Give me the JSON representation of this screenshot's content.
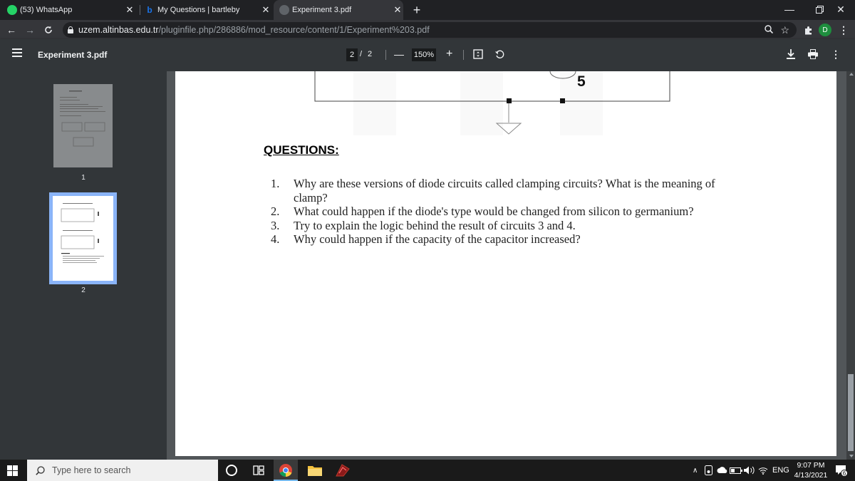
{
  "browser": {
    "tabs": [
      {
        "title": "(53) WhatsApp",
        "icon": "whatsapp-icon",
        "active": false
      },
      {
        "title": "My Questions | bartleby",
        "icon": "bartleby-icon",
        "active": false
      },
      {
        "title": "Experiment 3.pdf",
        "icon": "globe-icon",
        "active": true
      }
    ],
    "new_tab_label": "+",
    "url_host": "uzem.altinbas.edu.tr",
    "url_path": "/pluginfile.php/286886/mod_resource/content/1/Experiment%203.pdf",
    "profile_initial": "D"
  },
  "pdf_toolbar": {
    "title": "Experiment 3.pdf",
    "current_page": "2",
    "page_sep": "/",
    "total_pages": "2",
    "zoom": "150%",
    "zoom_out": "—",
    "zoom_in": "+"
  },
  "thumbnails": [
    {
      "page": "1",
      "selected": false
    },
    {
      "page": "2",
      "selected": true
    }
  ],
  "document": {
    "circuit_label": "5",
    "heading": "QUESTIONS:",
    "questions": [
      {
        "num": "1.",
        "text": "Why are these versions of diode circuits called clamping circuits? What is the meaning of clamp?"
      },
      {
        "num": "2.",
        "text": "What could happen if the diode's type would be changed from silicon to germanium?"
      },
      {
        "num": "3.",
        "text": "Try to explain the logic behind the result of circuits 3 and 4."
      },
      {
        "num": "4.",
        "text": "Why could happen if the capacity of the capacitor increased?"
      }
    ]
  },
  "taskbar": {
    "search_placeholder": "Type here to search",
    "language": "ENG",
    "time": "9:07 PM",
    "date": "4/13/2021",
    "notification_count": "6"
  }
}
